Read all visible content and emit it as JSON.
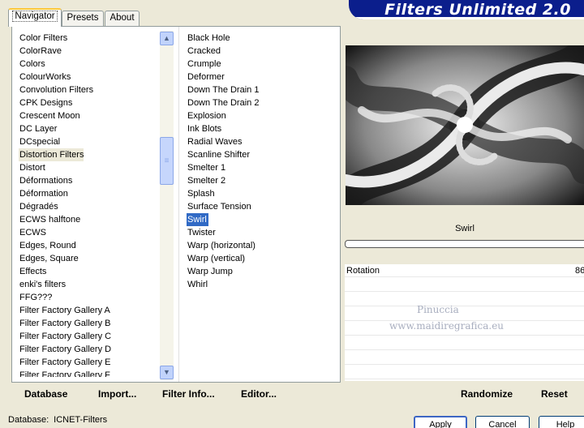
{
  "tabs": [
    {
      "label": "Navigator",
      "active": true
    },
    {
      "label": "Presets",
      "active": false
    },
    {
      "label": "About",
      "active": false
    }
  ],
  "app_title": "Filters Unlimited 2.0",
  "categories": {
    "selected": "Distortion Filters",
    "items": [
      "Color Filters",
      "ColorRave",
      "Colors",
      "ColourWorks",
      "Convolution Filters",
      "CPK Designs",
      "Crescent Moon",
      "DC Layer",
      "DCspecial",
      "Distortion Filters",
      "Distort",
      "Déformations",
      "Déformation",
      "Dégradés",
      "ECWS halftone",
      "ECWS",
      "Edges, Round",
      "Edges, Square",
      "Effects",
      "enki's filters",
      "FFG???",
      "Filter Factory Gallery A",
      "Filter Factory Gallery B",
      "Filter Factory Gallery C",
      "Filter Factory Gallery D",
      "Filter Factory Gallery E",
      "Filter Factory Gallery F"
    ]
  },
  "filters": {
    "selected": "Swirl",
    "items": [
      "Black Hole",
      "Cracked",
      "Crumple",
      "Deformer",
      "Down The Drain 1",
      "Down The Drain 2",
      "Explosion",
      "Ink Blots",
      "Radial Waves",
      "Scanline Shifter",
      "Smelter 1",
      "Smelter 2",
      "Splash",
      "Surface Tension",
      "Swirl",
      "Twister",
      "Warp (horizontal)",
      "Warp (vertical)",
      "Warp Jump",
      "Whirl"
    ]
  },
  "bottom_buttons": {
    "database": "Database",
    "import": "Import...",
    "filter_info": "Filter Info...",
    "editor": "Editor...",
    "randomize": "Randomize",
    "reset": "Reset"
  },
  "filter_panel": {
    "filter_name": "Swirl",
    "param_label": "Rotation",
    "param_value": "86"
  },
  "watermark": {
    "line1": "Pinuccia",
    "line2": "www.maidiregrafica.eu"
  },
  "status": {
    "label": "Database:",
    "value": "ICNET-Filters"
  },
  "actions": {
    "apply": "Apply",
    "cancel": "Cancel",
    "help": "Help"
  },
  "icons": {
    "scroll_up": "chevron-up-icon",
    "scroll_down": "chevron-down-icon",
    "thumb_grip": "grip-icon"
  },
  "colors": {
    "banner": "#0B1E8C",
    "selection": "#316AC5",
    "background": "#ECE9D8"
  }
}
